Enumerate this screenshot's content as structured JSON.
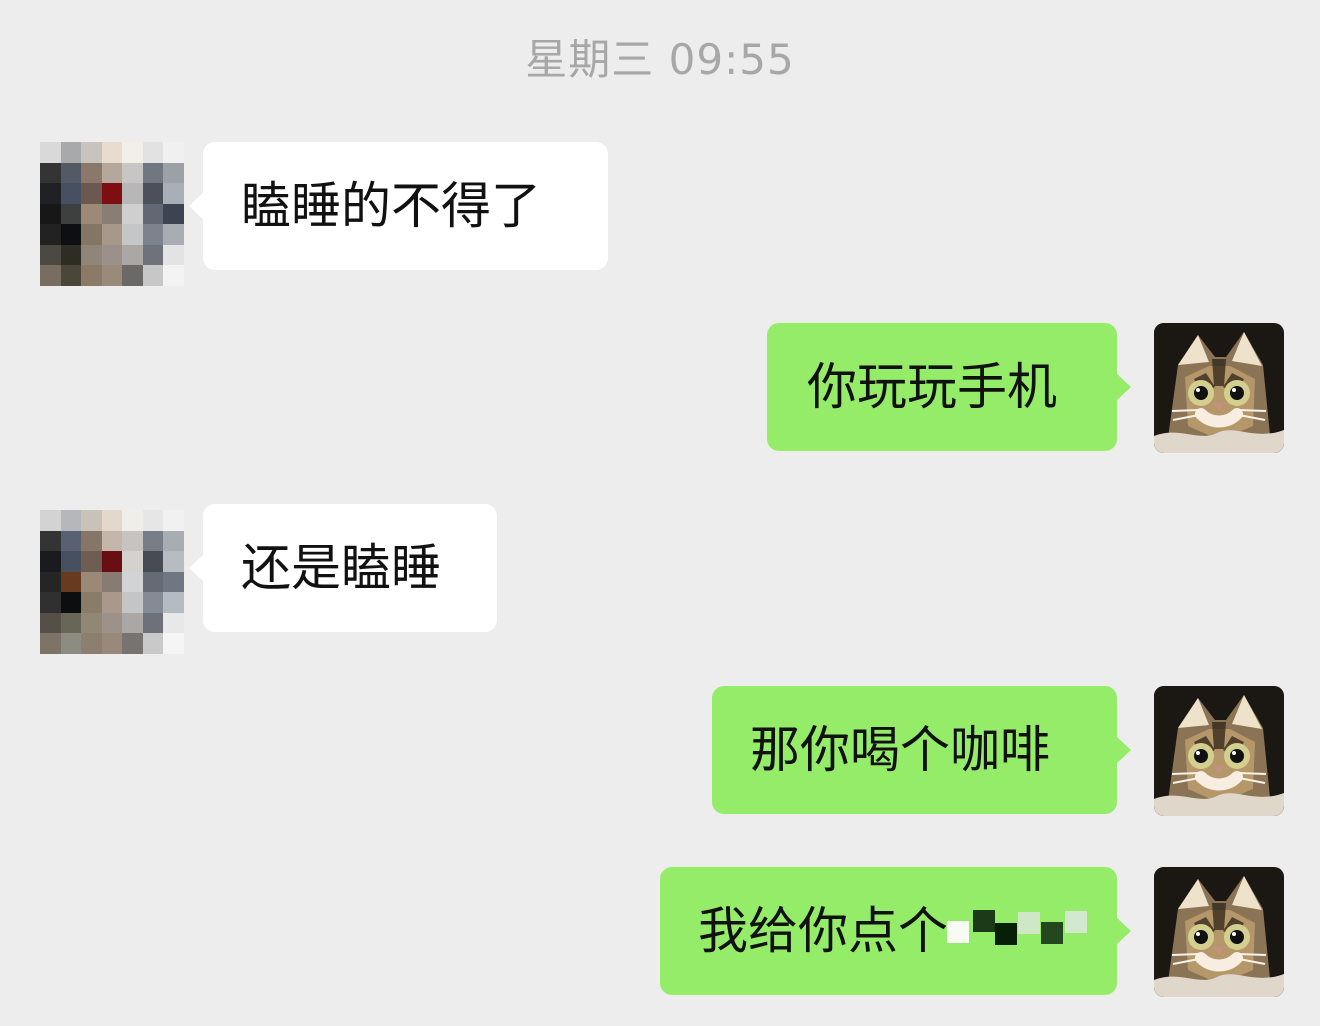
{
  "chat": {
    "timestamp": "星期三 09:55",
    "messages": [
      {
        "sender": "contact",
        "text": "瞌睡的不得了"
      },
      {
        "sender": "me",
        "text": "你玩玩手机"
      },
      {
        "sender": "contact",
        "text": "还是瞌睡"
      },
      {
        "sender": "me",
        "text": "那你喝个咖啡"
      },
      {
        "sender": "me",
        "text": "我给你点个"
      }
    ]
  },
  "icons": {
    "contact_avatar": "pixelated-avatar-icon",
    "self_avatar": "cat-avatar-icon",
    "obscured_text": "mosaic-icon"
  },
  "colors": {
    "background": "#ededed",
    "incoming_bubble": "#ffffff",
    "outgoing_bubble": "#95ec69",
    "timestamp": "#a7a7a7"
  }
}
